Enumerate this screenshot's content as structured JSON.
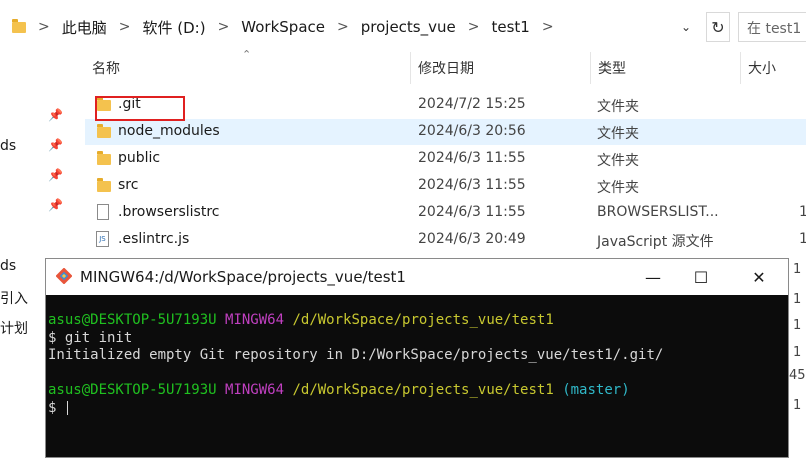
{
  "address_bar": {
    "crumbs": [
      "此电脑",
      "软件 (D:)",
      "WorkSpace",
      "projects_vue",
      "test1"
    ],
    "search_placeholder": "在 test1"
  },
  "columns": {
    "name": "名称",
    "date": "修改日期",
    "type": "类型",
    "size": "大小"
  },
  "files": [
    {
      "name": ".git",
      "date": "2024/7/2 15:25",
      "type": "文件夹",
      "size": ""
    },
    {
      "name": "node_modules",
      "date": "2024/6/3 20:56",
      "type": "文件夹",
      "size": ""
    },
    {
      "name": "public",
      "date": "2024/6/3 11:55",
      "type": "文件夹",
      "size": ""
    },
    {
      "name": "src",
      "date": "2024/6/3 11:55",
      "type": "文件夹",
      "size": ""
    },
    {
      "name": ".browserslistrc",
      "date": "2024/6/3 11:55",
      "type": "BROWSERSLIST...",
      "size": "1"
    },
    {
      "name": ".eslintrc.js",
      "date": "2024/6/3 20:49",
      "type": "JavaScript 源文件",
      "size": "1"
    }
  ],
  "sidebar_fragments": [
    "ds",
    "ds",
    "引入",
    "计划"
  ],
  "right_fragments": [
    "1",
    "1",
    "1",
    "1",
    "45",
    "1"
  ],
  "terminal": {
    "title": "MINGW64:/d/WorkSpace/projects_vue/test1",
    "user_host": "asus@DESKTOP-5U7193U",
    "shell": "MINGW64",
    "path": "/d/WorkSpace/projects_vue/test1",
    "command": "$ git init",
    "output": "Initialized empty Git repository in D:/WorkSpace/projects_vue/test1/.git/",
    "branch": "(master)",
    "prompt": "$"
  },
  "colors": {
    "selected_row": "#e5f3ff",
    "highlight_box": "#e02020",
    "folder": "#f4c24e"
  }
}
